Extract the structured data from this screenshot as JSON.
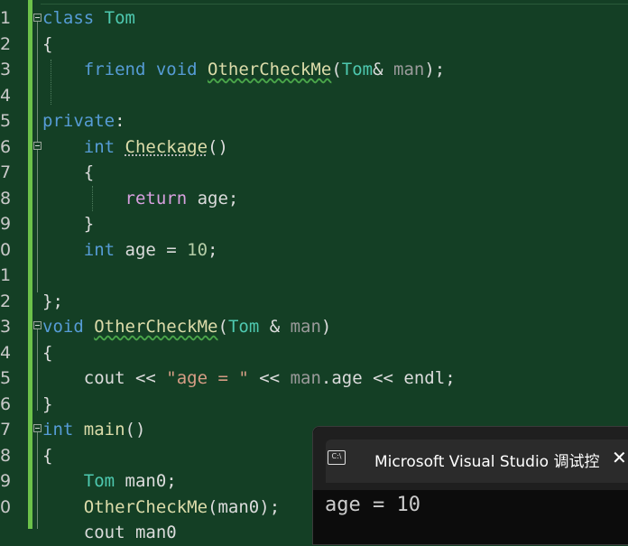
{
  "editor": {
    "line_numbers": [
      "1",
      "2",
      "3",
      "4",
      "5",
      "6",
      "7",
      "8",
      "9",
      "0",
      "1",
      "2",
      "3",
      "4",
      "5",
      "6",
      "7",
      "8",
      "9",
      "0"
    ],
    "lines": [
      [
        {
          "t": "class ",
          "c": "kw"
        },
        {
          "t": "Tom",
          "c": "cls"
        }
      ],
      [
        {
          "t": "{",
          "c": "op"
        }
      ],
      [
        {
          "t": "    friend ",
          "c": "kw"
        },
        {
          "t": "void ",
          "c": "kw"
        },
        {
          "t": "OtherCheckMe",
          "c": "fn wavy"
        },
        {
          "t": "(",
          "c": "op"
        },
        {
          "t": "Tom",
          "c": "cls"
        },
        {
          "t": "& ",
          "c": "op"
        },
        {
          "t": "man",
          "c": "par"
        },
        {
          "t": ");",
          "c": "op"
        }
      ],
      [],
      [
        {
          "t": "private",
          "c": "kw"
        },
        {
          "t": ":",
          "c": "op"
        }
      ],
      [
        {
          "t": "    int ",
          "c": "kw"
        },
        {
          "t": "Checkage",
          "c": "fn dotted"
        },
        {
          "t": "()",
          "c": "op"
        }
      ],
      [
        {
          "t": "    {",
          "c": "op"
        }
      ],
      [
        {
          "t": "        return ",
          "c": "kw2"
        },
        {
          "t": "age",
          "c": "op"
        },
        {
          "t": ";",
          "c": "op"
        }
      ],
      [
        {
          "t": "    }",
          "c": "op"
        }
      ],
      [
        {
          "t": "    int ",
          "c": "kw"
        },
        {
          "t": "age = ",
          "c": "op"
        },
        {
          "t": "10",
          "c": "num"
        },
        {
          "t": ";",
          "c": "op"
        }
      ],
      [],
      [
        {
          "t": "};",
          "c": "op"
        }
      ],
      [
        {
          "t": "void ",
          "c": "kw"
        },
        {
          "t": "OtherCheckMe",
          "c": "fn wavy"
        },
        {
          "t": "(",
          "c": "op"
        },
        {
          "t": "Tom",
          "c": "cls"
        },
        {
          "t": " & ",
          "c": "op"
        },
        {
          "t": "man",
          "c": "par"
        },
        {
          "t": ")",
          "c": "op"
        }
      ],
      [
        {
          "t": "{",
          "c": "op"
        }
      ],
      [
        {
          "t": "    cout ",
          "c": "op"
        },
        {
          "t": "<< ",
          "c": "op"
        },
        {
          "t": "\"age = \"",
          "c": "str"
        },
        {
          "t": " << ",
          "c": "op"
        },
        {
          "t": "man",
          "c": "par"
        },
        {
          "t": ".age ",
          "c": "op"
        },
        {
          "t": "<< ",
          "c": "op"
        },
        {
          "t": "endl",
          "c": "op"
        },
        {
          "t": ";",
          "c": "op"
        }
      ],
      [
        {
          "t": "}",
          "c": "op"
        }
      ],
      [
        {
          "t": "int ",
          "c": "kw"
        },
        {
          "t": "main",
          "c": "fn"
        },
        {
          "t": "()",
          "c": "op"
        }
      ],
      [
        {
          "t": "{",
          "c": "op"
        }
      ],
      [
        {
          "t": "    Tom ",
          "c": "cls"
        },
        {
          "t": "man0",
          "c": "op"
        },
        {
          "t": ";",
          "c": "op"
        }
      ],
      [
        {
          "t": "    OtherCheckMe",
          "c": "fn"
        },
        {
          "t": "(",
          "c": "op"
        },
        {
          "t": "man0",
          "c": "op"
        },
        {
          "t": ");",
          "c": "op"
        }
      ],
      [
        {
          "t": "    cout ",
          "c": "op"
        },
        {
          "t": "man0",
          "c": "op"
        }
      ]
    ]
  },
  "console": {
    "title": "Microsoft Visual Studio 调试控",
    "icon_label": "C:\\",
    "close_symbol": "✕",
    "output": "age = 10"
  }
}
